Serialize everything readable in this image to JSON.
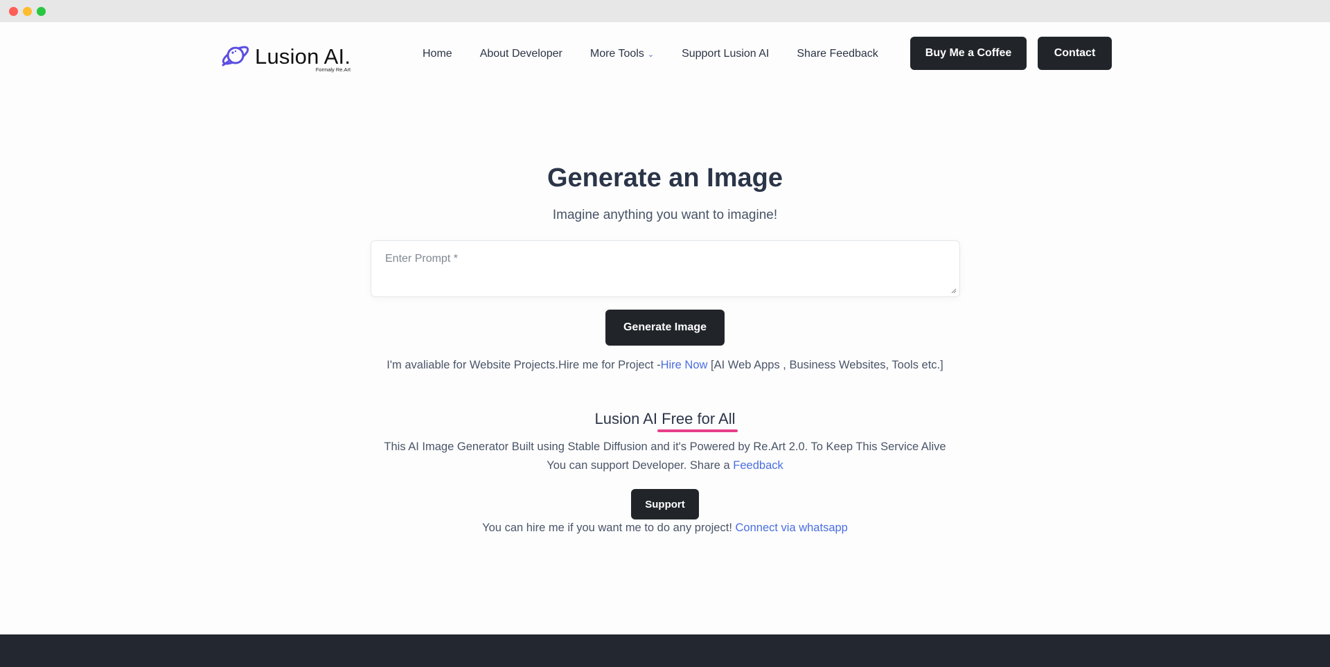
{
  "brand": {
    "name": "Lusion AI.",
    "subtitle": "Formaly Re.Art",
    "logo_color": "#5b4de0"
  },
  "nav": {
    "items": [
      {
        "label": "Home"
      },
      {
        "label": "About Developer"
      },
      {
        "label": "More Tools",
        "has_dropdown": true,
        "icon": "chevron-down-icon"
      },
      {
        "label": "Support Lusion AI"
      },
      {
        "label": "Share Feedback"
      }
    ],
    "coffee_button": "Buy Me a Coffee",
    "contact_button": "Contact"
  },
  "hero": {
    "title": "Generate an Image",
    "subtitle": "Imagine anything you want to imagine!",
    "prompt_placeholder": "Enter Prompt *",
    "prompt_value": "",
    "generate_button": "Generate Image"
  },
  "hire": {
    "text": "I'm avaliable for Website Projects.Hire me for Project -",
    "link": "Hire Now",
    "suffix": " [AI Web Apps , Business Websites, Tools etc.]"
  },
  "free_section": {
    "title_plain": "Lusion AI ",
    "title_highlight": "Free for All",
    "desc_line1": "This AI Image Generator Built using Stable Diffusion and it's Powered by Re.Art 2.0. To Keep This Service Alive",
    "desc_line2_prefix": "You can support Developer. Share a ",
    "desc_line2_link": "Feedback",
    "support_button": "Support",
    "connect_text": "You can hire me if you want me to do any project! ",
    "connect_link": "Connect via whatsapp"
  },
  "colors": {
    "accent_link": "#4a6ee0",
    "button_dark": "#212529",
    "highlight_underline": "#e83e8c",
    "footer": "#23272f"
  }
}
